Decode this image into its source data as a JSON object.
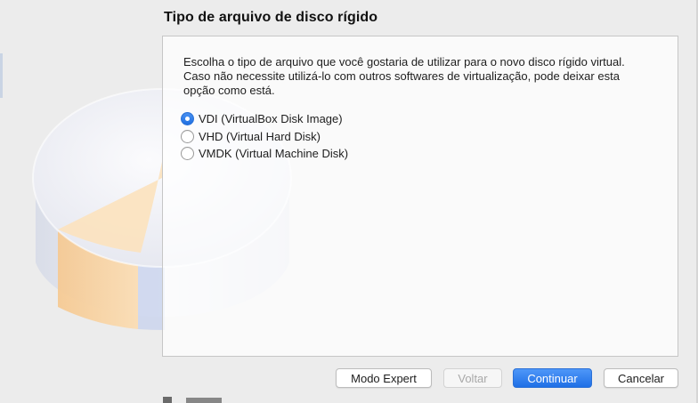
{
  "title": "Tipo de arquivo de disco rígido",
  "description": {
    "line1": "Escolha o tipo de arquivo que você gostaria de utilizar para o novo disco rígido virtual.",
    "line2": "Caso não necessite utilizá-lo com outros softwares de virtualização, pode deixar esta",
    "line3": "opção como está."
  },
  "options": [
    {
      "label": "VDI (VirtualBox Disk Image)",
      "selected": true
    },
    {
      "label": "VHD (Virtual Hard Disk)",
      "selected": false
    },
    {
      "label": "VMDK (Virtual Machine Disk)",
      "selected": false
    }
  ],
  "buttons": {
    "expert": "Modo Expert",
    "back": "Voltar",
    "continue": "Continuar",
    "cancel": "Cancelar"
  },
  "colors": {
    "accent": "#1f6fe6",
    "window_bg": "#ececec",
    "disk_highlight": "#f7c98a"
  },
  "icons": {
    "illustration": "hard-disk-illustration"
  }
}
